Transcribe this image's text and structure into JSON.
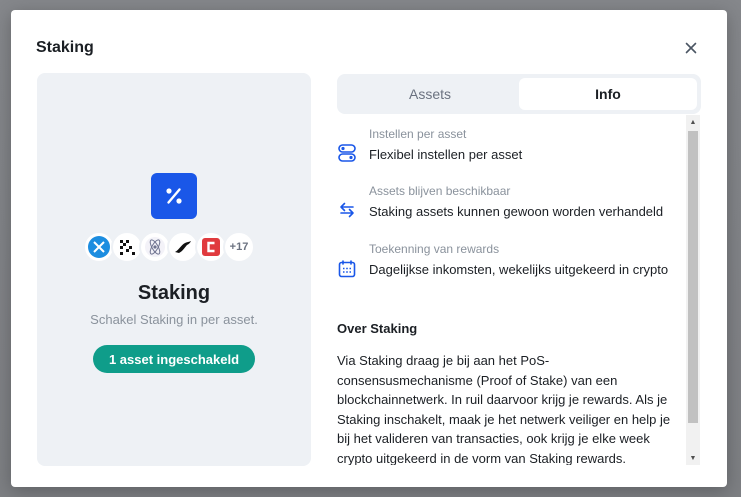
{
  "modal": {
    "title": "Staking"
  },
  "card": {
    "title": "Staking",
    "subtitle": "Schakel Staking in per asset.",
    "more_count": "+17",
    "status": "1 asset ingeschakeld",
    "coins": [
      "multiversx-icon",
      "polymesh-icon",
      "cosmos-icon",
      "kava-bird-icon",
      "cartesi-icon"
    ]
  },
  "tabs": [
    {
      "label": "Assets",
      "active": false
    },
    {
      "label": "Info",
      "active": true
    }
  ],
  "info": {
    "features": [
      {
        "label": "Instellen per asset",
        "text": "Flexibel instellen per asset",
        "icon": "toggle-settings-icon"
      },
      {
        "label": "Assets blijven beschikbaar",
        "text": "Staking assets kunnen gewoon worden verhandeld",
        "icon": "swap-arrows-icon"
      },
      {
        "label": "Toekenning van rewards",
        "text": "Dagelijkse inkomsten, wekelijks uitgekeerd in crypto",
        "icon": "calendar-icon"
      }
    ],
    "section_title": "Over Staking",
    "body": "Via Staking draag je bij aan het PoS-consensusmechanisme (Proof of Stake) van een blockchainnetwerk. In ruil daarvoor krijg je rewards. Als je Staking inschakelt, maak je het netwerk veiliger en help je bij het valideren van transacties, ook krijg je elke week crypto uitgekeerd in de vorm van Staking rewards."
  },
  "colors": {
    "accent": "#1a57e8",
    "status": "#0f9d8a"
  }
}
